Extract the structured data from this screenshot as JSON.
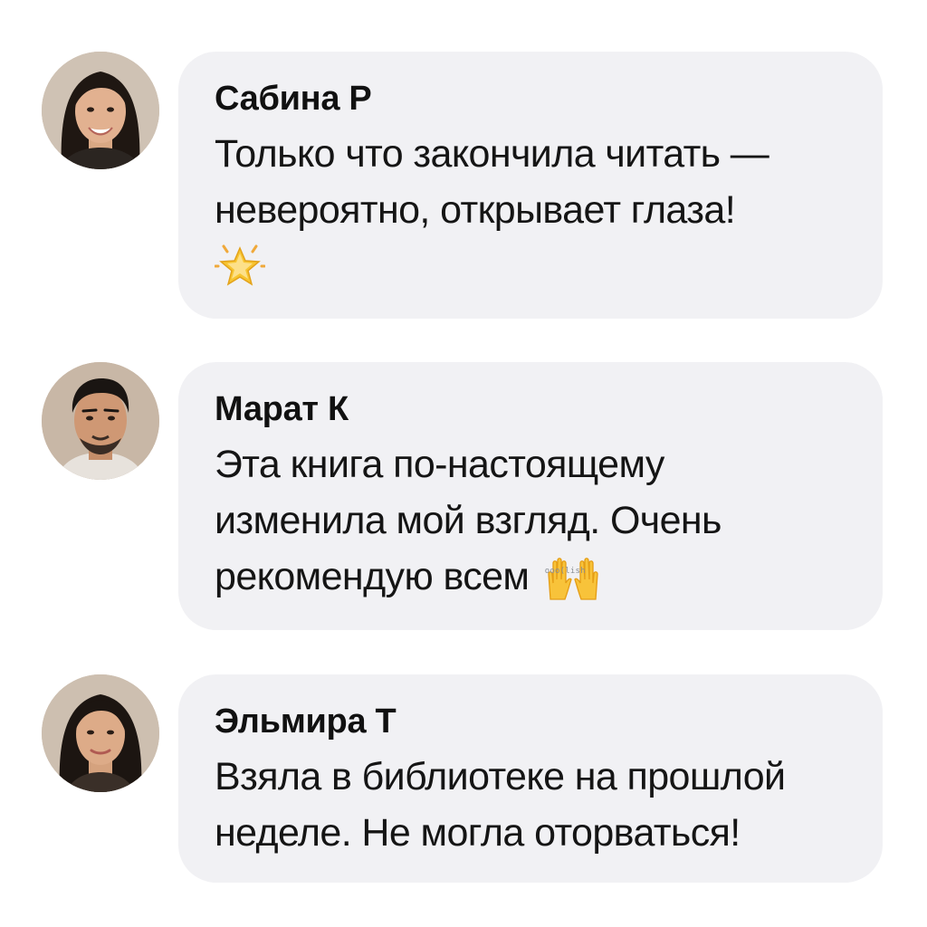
{
  "comments": [
    {
      "author": "Сабина Р",
      "line1": "Только что закончила читать —",
      "line2": "невероятно, открывает глаза!",
      "emoji": "star-icon"
    },
    {
      "author": "Марат К",
      "line1": "Эта книга по-настоящему",
      "line2": "изменила мой взгляд. Очень",
      "line3": "рекомендую всем",
      "emoji": "raised-hands-icon",
      "emoji_caption": "ooo(lish"
    },
    {
      "author": "Эльмира Т",
      "line1": "Взяла в библиотеке на прошлой",
      "line2": "неделе. Не могла оторваться!"
    }
  ],
  "colors": {
    "bubble": "#f1f1f4",
    "text": "#151515",
    "background": "#ffffff"
  }
}
